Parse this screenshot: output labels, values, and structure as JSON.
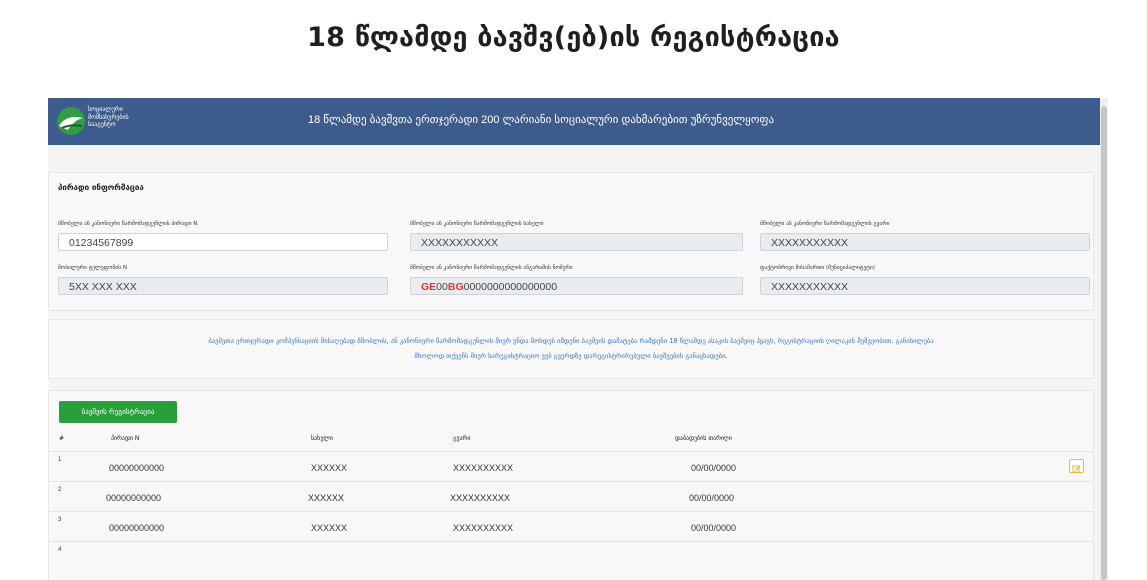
{
  "page_title": "18 წლამდე ბავშვ(ებ)ის რეგისტრაცია",
  "header": {
    "logo_lines": [
      "სოციალური",
      "მომსახურების",
      "სააგენტო"
    ],
    "title": "18 წლამდე ბავშვთა ერთჯერადი 200 ლარიანი სოციალური დახმარებით უზრუნველყოფა",
    "colors": {
      "header_bg": "#3d5b8c",
      "button_green": "#27a03a",
      "notice_blue": "#3f76c5",
      "iban_red": "#e23a3a"
    }
  },
  "personal": {
    "heading": "პირადი ინფორმაცია",
    "fields": [
      {
        "label": "მშობელი ან კანონიერი წარმომადგენლის პირადი N",
        "value": "01234567899"
      },
      {
        "label": "მშობელი ან კანონიერი წარმომადგენლის სახელი",
        "value": "XXXXXXXXXXX"
      },
      {
        "label": "მშობელი ან კანონიერი წარმომადგენლის გვარი",
        "value": "XXXXXXXXXXX"
      },
      {
        "label": "მობილური ტელეფონის N",
        "value": "5XX XXX XXX"
      },
      {
        "label": "მშობელი ან კანონიერი წარმომადგენლის ანგარიშის ნომერი",
        "iban_cc": "GE",
        "iban_check": "00",
        "iban_bank": "BG",
        "iban_rest": "0000000000000000"
      },
      {
        "label": "ფაქტობრივი მისამართი (მუნიციპალიტეტი)",
        "value": "XXXXXXXXXXX"
      }
    ]
  },
  "notice": {
    "line1": "ბავშვთა ერთჯერადი კომპენსაციის მისაღებად მშობლის, ან კანონიერი წარმომადგენლის   მიერ უნდა მოხდეს იმდენი ბავშვის დამატება რამდენი 18 წლამდე ასაკის ბავშვიც ჰყავს, რეგისტრაციის ღილაკის მეშვეობით. განიხილება",
    "line2": "მხოლოდ თქვენს მიერ სარეგისტრაციო ვებ გვერდზე დარეგისტრირებული ბავშვების განაცხადები."
  },
  "children": {
    "register_button": "ბავშვის რეგისტრაცია",
    "columns": [
      "#",
      "პირადი N",
      "სახელი",
      "გვარი",
      "დაბადების თარიღი"
    ],
    "rows": [
      {
        "num": "1",
        "pid": "00000000000",
        "name": "XXXXXX",
        "surname": "XXXXXXXXXX",
        "dob": "00/00/0000"
      },
      {
        "num": "2",
        "pid": "00000000000",
        "name": "XXXXXX",
        "surname": "XXXXXXXXXX",
        "dob": "00/00/0000"
      },
      {
        "num": "3",
        "pid": "00000000000",
        "name": "XXXXXX",
        "surname": "XXXXXXXXXX",
        "dob": "00/00/0000"
      },
      {
        "num": "4"
      }
    ]
  }
}
